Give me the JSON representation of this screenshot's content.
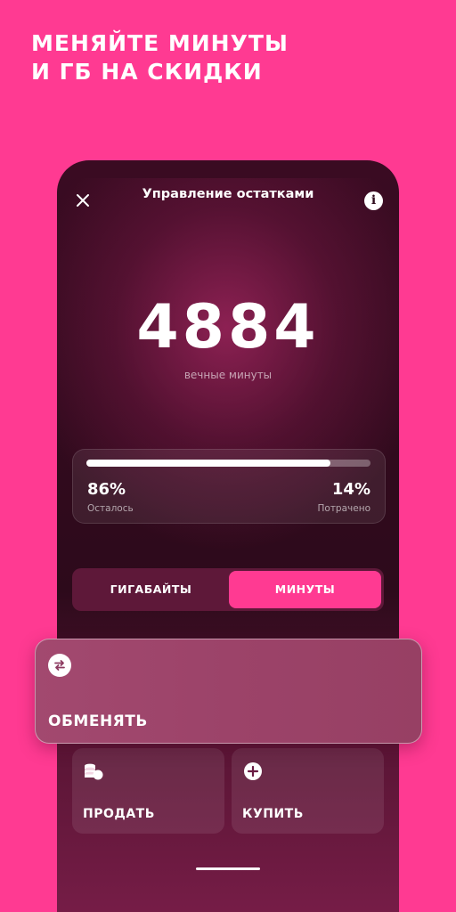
{
  "promo": {
    "line1": "МЕНЯЙТЕ МИНУТЫ",
    "line2": "И ГБ НА СКИДКИ"
  },
  "header": {
    "title": "Управление остатками",
    "close_icon": "close-icon",
    "info_icon": "info-icon",
    "info_glyph": "i"
  },
  "balance": {
    "value": "4884",
    "caption": "вечные минуты"
  },
  "usage": {
    "remaining_fraction": 0.86,
    "remaining_value": "86%",
    "remaining_label": "Осталось",
    "spent_value": "14%",
    "spent_label": "Потрачено"
  },
  "tabs": [
    {
      "label": "ГИГАБАЙТЫ",
      "active": false
    },
    {
      "label": "МИНУТЫ",
      "active": true
    }
  ],
  "actions": {
    "exchange": {
      "label": "ОБМЕНЯТЬ",
      "icon": "swap-icon"
    },
    "sell": {
      "label": "ПРОДАТЬ",
      "icon": "coins-icon"
    },
    "buy": {
      "label": "КУПИТЬ",
      "icon": "plus-icon"
    }
  },
  "colors": {
    "brand_pink": "#FF3A92",
    "screen_dark": "#2D0A1B",
    "accent_white": "#FFFFFF"
  }
}
